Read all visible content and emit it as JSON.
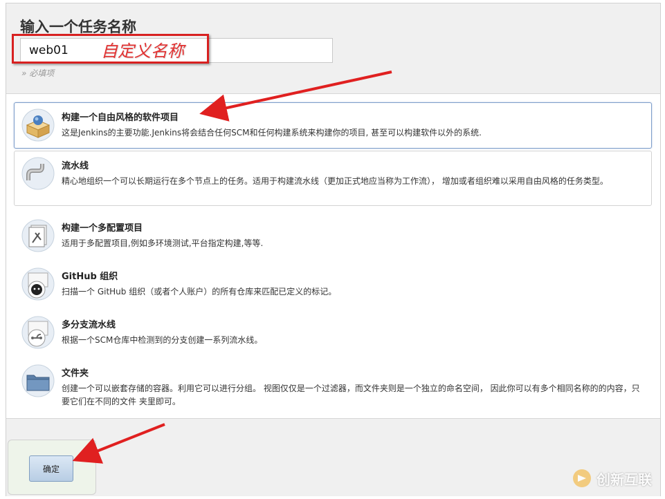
{
  "header": {
    "title": "输入一个任务名称",
    "name_value": "web01",
    "annotation": "自定义名称",
    "required_note": "» 必填项"
  },
  "items": [
    {
      "title": "构建一个自由风格的软件项目",
      "desc": "这是Jenkins的主要功能.Jenkins将会结合任何SCM和任何构建系统来构建你的项目, 甚至可以构建软件以外的系统.",
      "icon": "freestyle-box-icon"
    },
    {
      "title": "流水线",
      "desc": "精心地组织一个可以长期运行在多个节点上的任务。适用于构建流水线（更加正式地应当称为工作流）， 增加或者组织难以采用自由风格的任务类型。",
      "icon": "pipeline-icon"
    },
    {
      "title": "构建一个多配置项目",
      "desc": "适用于多配置项目,例如多环境测试,平台指定构建,等等.",
      "icon": "multi-config-icon"
    },
    {
      "title": "GitHub 组织",
      "desc": "扫描一个 GitHub 组织（或者个人账户）的所有仓库来匹配已定义的标记。",
      "icon": "github-octocat-icon"
    },
    {
      "title": "多分支流水线",
      "desc": "根据一个SCM仓库中检测到的分支创建一系列流水线。",
      "icon": "branch-icon"
    },
    {
      "title": "文件夹",
      "desc": "创建一个可以嵌套存储的容器。利用它可以进行分组。 视图仅仅是一个过滤器，而文件夹则是一个独立的命名空间， 因此你可以有多个相同名称的的内容，只要它们在不同的文件 夹里即可。",
      "icon": "folder-icon"
    }
  ],
  "footer": {
    "ok_label": "确定"
  },
  "watermark": {
    "text": "创新互联"
  },
  "colors": {
    "annotation_red": "#e23030",
    "selected_border": "#7e9ecb",
    "header_bg": "#f0f0f0"
  }
}
